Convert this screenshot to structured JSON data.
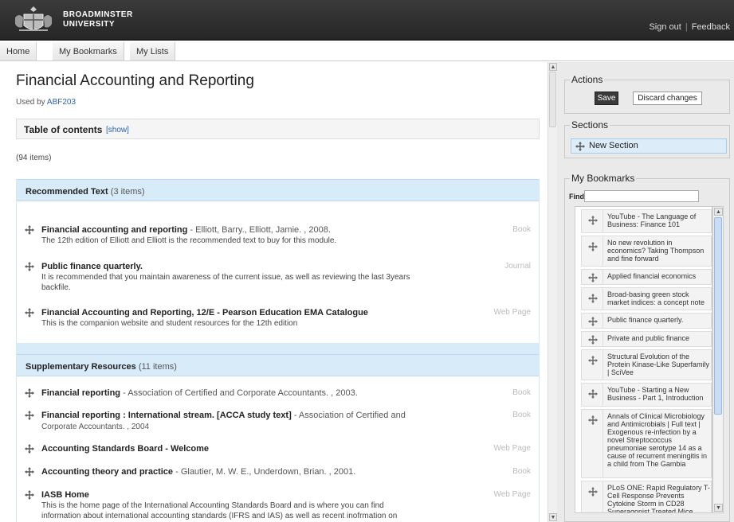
{
  "header": {
    "brand_line1": "BROADMINSTER",
    "brand_line2": "UNIVERSITY",
    "sign_out": "Sign out",
    "separator": "|",
    "feedback": "Feedback"
  },
  "nav": {
    "tabs": [
      {
        "label": "Home"
      },
      {
        "label": "My Bookmarks"
      },
      {
        "label": "My Lists"
      }
    ]
  },
  "list": {
    "title": "Financial Accounting and Reporting",
    "used_by_prefix": "Used by",
    "used_by_link": "ABF203",
    "toc_title": "Table of contents",
    "toc_show": "[show]",
    "item_count": "(94 items)"
  },
  "sections": [
    {
      "title": "Recommended Text",
      "count": "(3 items)",
      "items": [
        {
          "title": "Financial accounting and reporting",
          "author": "- Elliott, Barry., Elliott, Jamie. , 2008.",
          "type": "Book",
          "note": "The 12th edition of Elliott and Elliott is the recommended text to buy for this module."
        },
        {
          "title": "Public finance quarterly.",
          "author": "",
          "type": "Journal",
          "note": "It is recommended that you maintain awareness of the current issue, as well as reviewing the last 3years backfile."
        },
        {
          "title": "Financial Accounting and Reporting, 12/E - Pearson Education EMA Catalogue",
          "author": "",
          "type": "Web Page",
          "note": "This is the companion website and student resources for the 12th edition"
        }
      ]
    },
    {
      "title": "Supplementary Resources",
      "count": "(11 items)",
      "items": [
        {
          "title": "Financial reporting",
          "author": "- Association of Certified and Corporate Accountants. , 2003.",
          "type": "Book",
          "note": ""
        },
        {
          "title": "Financial reporting : International stream. [ACCA study text]",
          "author": "- Association of Certified and",
          "author2": "Corporate Accountants. , 2004",
          "type": "Book",
          "note": ""
        },
        {
          "title": "Accounting Standards Board - Welcome",
          "author": "",
          "type": "Web Page",
          "note": ""
        },
        {
          "title": "Accounting theory and practice",
          "author": "- Glautier, M. W. E., Underdown, Brian. , 2001.",
          "type": "Book",
          "note": ""
        },
        {
          "title": "IASB Home",
          "author": "",
          "type": "Web Page",
          "note": "This is the home page of the International Accounting Standards Board and is where you can find information about international accounting standards (IFRS and IAS) as well as recent inofrmation on"
        }
      ]
    }
  ],
  "side": {
    "actions_legend": "Actions",
    "save": "Save",
    "discard": "Discard changes",
    "sections_legend": "Sections",
    "new_section": "New Section",
    "bookmarks_legend": "My Bookmarks",
    "find_label": "Find:",
    "find_value": "",
    "bookmarks": [
      "YouTube - The Language of Business: Finance 101",
      "No new revolution in economics? Taking Thompson and fine forward",
      "Applied financial economics",
      "Broad-basing green stock market indices: a concept note",
      "Public finance quarterly.",
      "Private and public finance",
      "Structural Evolution of the Protein Kinase-Like Superfamily | SciVee",
      "YouTube - Starting a New Business - Part 1, Introduction",
      "Annals of Clinical Microbiology and Antimicrobials | Full text | Exogenous re-infection by a novel Streptococcus pneumoniae serotype 14 as a cause of recurrent meningitis in a child from The Gambia",
      "PLoS ONE: Rapid Regulatory T-Cell Response Prevents Cytokine Storm in CD28 Superagonist Treated Mice"
    ]
  },
  "colors": {
    "topbar": "#2e2e2e",
    "section_header": "#d8ebf9",
    "link": "#2a64b0",
    "save_button": "#3a3a3a"
  }
}
